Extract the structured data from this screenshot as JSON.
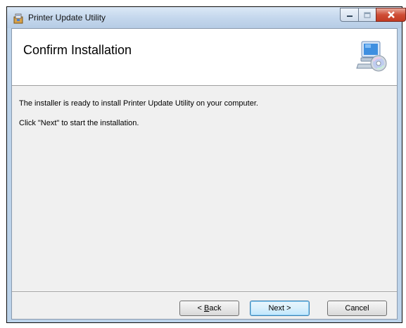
{
  "window": {
    "title": "Printer Update Utility",
    "app_icon": "installer-icon",
    "controls": {
      "minimize_icon": "minimize-icon",
      "maximize_icon": "maximize-icon",
      "close_icon": "close-icon"
    }
  },
  "banner": {
    "title": "Confirm Installation",
    "icon": "computer-cd-icon"
  },
  "body": {
    "line1": "The installer is ready to install Printer Update Utility on your computer.",
    "line2": "Click \"Next\" to start the installation."
  },
  "buttons": {
    "back_mnemonic": "B",
    "back_rest": "ack",
    "back_prefix": "< ",
    "next": "Next >",
    "cancel": "Cancel"
  }
}
